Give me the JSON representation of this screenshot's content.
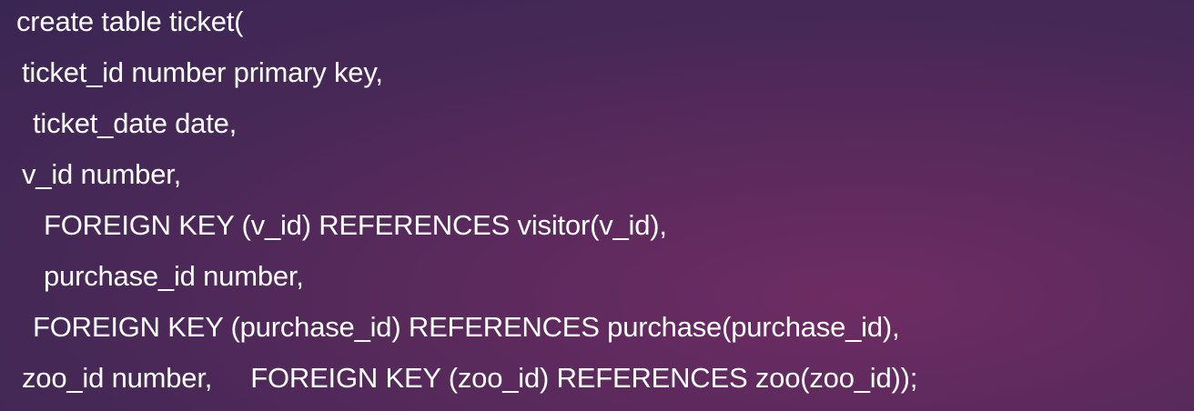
{
  "code": {
    "lines": [
      "create table ticket(",
      "ticket_id number primary key,",
      "ticket_date date,",
      "v_id number,",
      "FOREIGN KEY (v_id) REFERENCES visitor(v_id),",
      "purchase_id number,",
      "FOREIGN KEY (purchase_id) REFERENCES purchase(purchase_id),",
      "zoo_id number,     FOREIGN KEY (zoo_id) REFERENCES zoo(zoo_id));"
    ]
  },
  "colors": {
    "background": "#4a2858",
    "text": "#ffffff"
  }
}
